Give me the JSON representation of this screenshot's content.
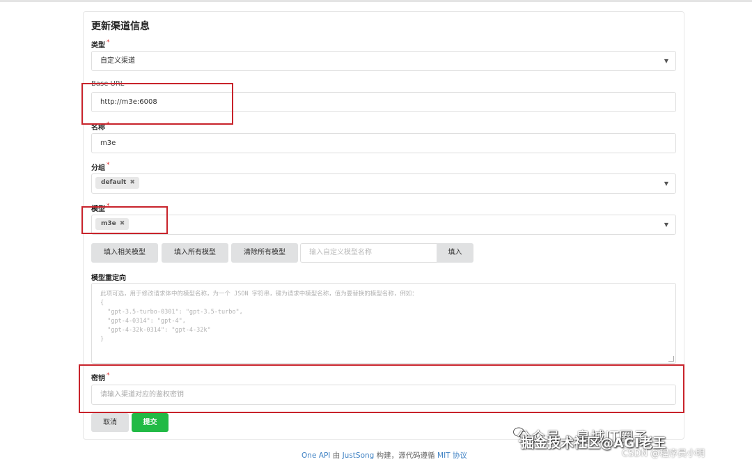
{
  "form": {
    "title": "更新渠道信息",
    "type_label": "类型",
    "type_value": "自定义渠道",
    "base_url_label": "Base URL",
    "base_url_value": "http://m3e:6008",
    "name_label": "名称",
    "name_value": "m3e",
    "group_label": "分组",
    "group_chip": "default",
    "model_label": "模型",
    "model_chip": "m3e",
    "required_mark": "*",
    "chip_remove": "✖",
    "buttons": {
      "fill_related": "填入相关模型",
      "fill_all": "填入所有模型",
      "clear_all": "清除所有模型",
      "custom_model_placeholder": "输入自定义模型名称",
      "fill_in": "填入"
    },
    "redirect_label": "模型重定向",
    "redirect_placeholder": "此项可选，用于修改请求体中的模型名称，为一个 JSON 字符串，键为请求中模型名称，值为要替换的模型名称，例如：\n{\n  \"gpt-3.5-turbo-0301\": \"gpt-3.5-turbo\",\n  \"gpt-4-0314\": \"gpt-4\",\n  \"gpt-4-32k-0314\": \"gpt-4-32k\"\n}",
    "key_label": "密钥",
    "key_placeholder": "请输入渠道对应的鉴权密钥",
    "cancel": "取消",
    "submit": "提交"
  },
  "footer": {
    "project": "One API",
    "by": " 由 ",
    "author": "JustSong",
    "built": " 构建，源代码遵循 ",
    "license": "MIT 协议"
  },
  "watermark": {
    "line1": "公众号 · 皇城IT圈子",
    "line2": "掘金技术社区@AGI老王",
    "line3": "CSDN @程序员小明"
  },
  "colors": {
    "highlight": "#c8232b",
    "submit": "#21ba45",
    "link": "#4183c4"
  }
}
